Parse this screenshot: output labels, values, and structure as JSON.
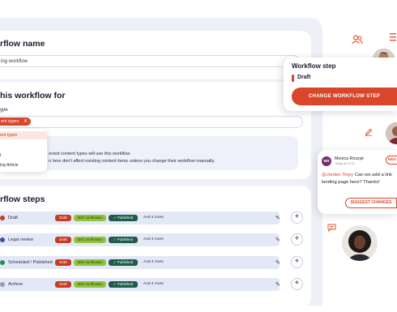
{
  "workflow_name": {
    "heading": "rflow name",
    "input_value": "ing workflow"
  },
  "enable_for": {
    "heading": "his workflow for",
    "type_label": "ype",
    "chip_label": "ent types",
    "chip_remove": "✕",
    "dropdown": [
      "ent types",
      "t",
      "ing Article"
    ],
    "info_line_1": "ected content types will use this workflow.",
    "info_line_2": "n here don't affect existing content items unless you change their workflow manually."
  },
  "workflow_steps": {
    "heading": "rflow steps",
    "rows": [
      {
        "name": "Draft",
        "dot_color": "#c73a23",
        "tags": [
          "Draft",
          "SEO verification",
          "✓ Published"
        ],
        "more": "And 4 more"
      },
      {
        "name": "Legal review",
        "dot_color": "#3a52a8",
        "tags": [
          "Draft",
          "SEO verification",
          "✓ Published"
        ],
        "more": "And 4 more"
      },
      {
        "name": "Scheduled / Published",
        "dot_color": "#2c8a5a",
        "tags": [
          "Draft",
          "SEO verification",
          "✓ Published"
        ],
        "more": "And 4 more"
      },
      {
        "name": "Archive",
        "dot_color": "#9a9aaa",
        "tags": [
          "Draft",
          "SEO verification",
          "✓ Published"
        ],
        "more": "And 4 more"
      }
    ]
  },
  "workflow_popover": {
    "title": "Workflow step",
    "current_step": "Draft",
    "button_label": "CHANGE WORKFLOW STEP",
    "accent": "#d9462a"
  },
  "comment": {
    "initials": "MR",
    "author": "Monica Roszyk",
    "time": "Today at 22:12",
    "resolve_label": "RES",
    "mention": "@Jordan Torpy",
    "text": " Can we add a link landing page here? Thanks!",
    "suggest_label": "SUGGEST CHANGES"
  },
  "icons": [
    "users-icon",
    "list-icon",
    "pencil-icon",
    "chat-icon",
    "edit-icon",
    "plus-icon"
  ]
}
